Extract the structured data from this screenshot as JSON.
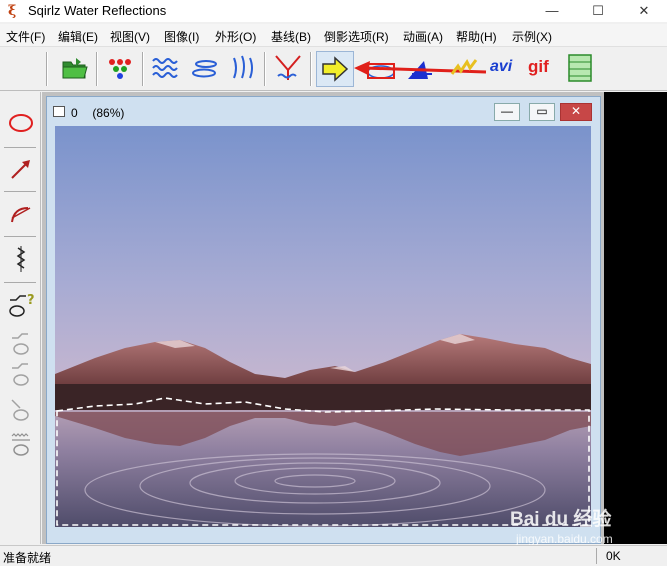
{
  "window": {
    "title": "Sqirlz Water Reflections",
    "minimize_glyph": "—",
    "maximize_glyph": "☐",
    "close_glyph": "✕"
  },
  "menu": [
    {
      "label": "文件(F)"
    },
    {
      "label": "编辑(E)"
    },
    {
      "label": "视图(V)"
    },
    {
      "label": "图像(I)"
    },
    {
      "label": "外形(O)"
    },
    {
      "label": "基线(B)"
    },
    {
      "label": "倒影选项(R)"
    },
    {
      "label": "动画(A)"
    },
    {
      "label": "帮助(H)"
    },
    {
      "label": "示例(X)"
    }
  ],
  "toolbar": {
    "avi_label": "avi",
    "gif_label": "gif",
    "highlighted_tool": "reflection-apply-arrow",
    "annotation_color": "#e0201a",
    "arrow_color": "#f2ee2a"
  },
  "child_window": {
    "number": "0",
    "zoom": "(86%)",
    "minimize_glyph": "—",
    "maximize_glyph": "▭",
    "close_glyph": "✕"
  },
  "status": {
    "left": "准备就绪",
    "right": "0K"
  },
  "watermark": {
    "brand": "Bai du 经验",
    "url": "jingyan.baidu.com"
  }
}
